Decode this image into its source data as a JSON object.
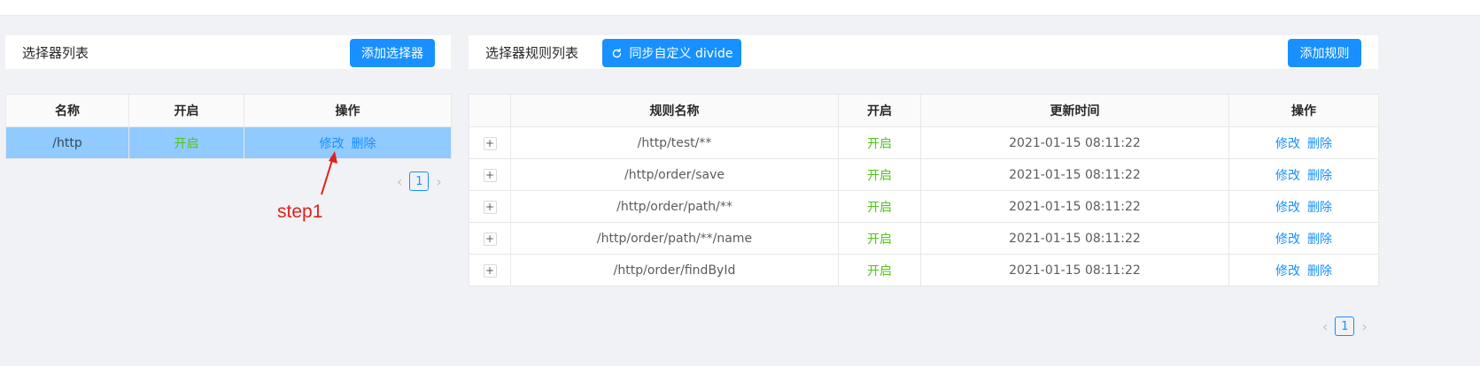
{
  "left_panel": {
    "title": "选择器列表",
    "add_button": "添加选择器",
    "table": {
      "headers": [
        "名称",
        "开启",
        "操作"
      ],
      "rows": [
        {
          "name": "/http",
          "status": "开启",
          "edit": "修改",
          "delete": "删除"
        }
      ]
    },
    "pager": {
      "prev": "‹",
      "page": "1",
      "next": "›"
    }
  },
  "right_panel": {
    "title": "选择器规则列表",
    "sync_button": "同步自定义 divide",
    "add_button": "添加规则",
    "table": {
      "headers": [
        "",
        "规则名称",
        "开启",
        "更新时间",
        "操作"
      ],
      "rows": [
        {
          "expand": "+",
          "name": "/http/test/**",
          "status": "开启",
          "updated": "2021-01-15 08:11:22",
          "edit": "修改",
          "delete": "删除"
        },
        {
          "expand": "+",
          "name": "/http/order/save",
          "status": "开启",
          "updated": "2021-01-15 08:11:22",
          "edit": "修改",
          "delete": "删除"
        },
        {
          "expand": "+",
          "name": "/http/order/path/**",
          "status": "开启",
          "updated": "2021-01-15 08:11:22",
          "edit": "修改",
          "delete": "删除"
        },
        {
          "expand": "+",
          "name": "/http/order/path/**/name",
          "status": "开启",
          "updated": "2021-01-15 08:11:22",
          "edit": "修改",
          "delete": "删除"
        },
        {
          "expand": "+",
          "name": "/http/order/findById",
          "status": "开启",
          "updated": "2021-01-15 08:11:22",
          "edit": "修改",
          "delete": "删除"
        }
      ]
    },
    "pager": {
      "prev": "‹",
      "page": "1",
      "next": "›"
    }
  },
  "annotation": {
    "text": "step1",
    "color": "#e0201b"
  },
  "colors": {
    "primary": "#1890ff",
    "enabled": "#52c41a",
    "selected_row": "#91caff",
    "background": "#f0f2f5"
  }
}
